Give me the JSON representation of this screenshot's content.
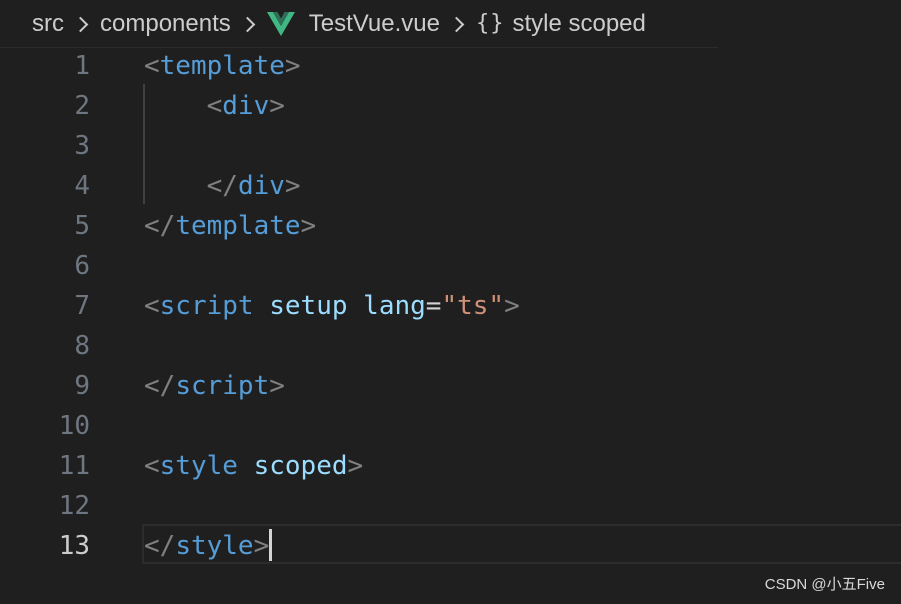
{
  "breadcrumb": {
    "items": [
      "src",
      "components",
      "TestVue.vue",
      "style scoped"
    ],
    "icons": [
      "vue-icon",
      "braces-icon"
    ]
  },
  "editor": {
    "lines": [
      {
        "number": "1",
        "tokens": [
          [
            "punc",
            "<"
          ],
          [
            "tag",
            "template"
          ],
          [
            "punc",
            ">"
          ]
        ]
      },
      {
        "number": "2",
        "tokens": [
          [
            "ws",
            "    "
          ],
          [
            "punc",
            "<"
          ],
          [
            "tag",
            "div"
          ],
          [
            "punc",
            ">"
          ]
        ]
      },
      {
        "number": "3",
        "tokens": []
      },
      {
        "number": "4",
        "tokens": [
          [
            "ws",
            "    "
          ],
          [
            "punc",
            "</"
          ],
          [
            "tag",
            "div"
          ],
          [
            "punc",
            ">"
          ]
        ]
      },
      {
        "number": "5",
        "tokens": [
          [
            "punc",
            "</"
          ],
          [
            "tag",
            "template"
          ],
          [
            "punc",
            ">"
          ]
        ]
      },
      {
        "number": "6",
        "tokens": []
      },
      {
        "number": "7",
        "tokens": [
          [
            "punc",
            "<"
          ],
          [
            "tag",
            "script"
          ],
          [
            "ws",
            " "
          ],
          [
            "attr",
            "setup"
          ],
          [
            "ws",
            " "
          ],
          [
            "attr",
            "lang"
          ],
          [
            "eq",
            "="
          ],
          [
            "str",
            "\"ts\""
          ],
          [
            "punc",
            ">"
          ]
        ]
      },
      {
        "number": "8",
        "tokens": []
      },
      {
        "number": "9",
        "tokens": [
          [
            "punc",
            "</"
          ],
          [
            "tag",
            "script"
          ],
          [
            "punc",
            ">"
          ]
        ]
      },
      {
        "number": "10",
        "tokens": []
      },
      {
        "number": "11",
        "tokens": [
          [
            "punc",
            "<"
          ],
          [
            "tag",
            "style"
          ],
          [
            "ws",
            " "
          ],
          [
            "attr",
            "scoped"
          ],
          [
            "punc",
            ">"
          ]
        ]
      },
      {
        "number": "12",
        "tokens": []
      },
      {
        "number": "13",
        "tokens": [
          [
            "punc",
            "</"
          ],
          [
            "tag",
            "style"
          ],
          [
            "punc",
            ">"
          ]
        ],
        "active": true
      }
    ]
  },
  "watermark": "CSDN @小五Five",
  "colors": {
    "background": "#1f1f1f",
    "tag": "#569cd6",
    "attribute": "#9cdcfe",
    "string": "#ce9178",
    "punctuation": "#808080",
    "line_number": "#6e7681",
    "vue_green": "#41b883"
  }
}
